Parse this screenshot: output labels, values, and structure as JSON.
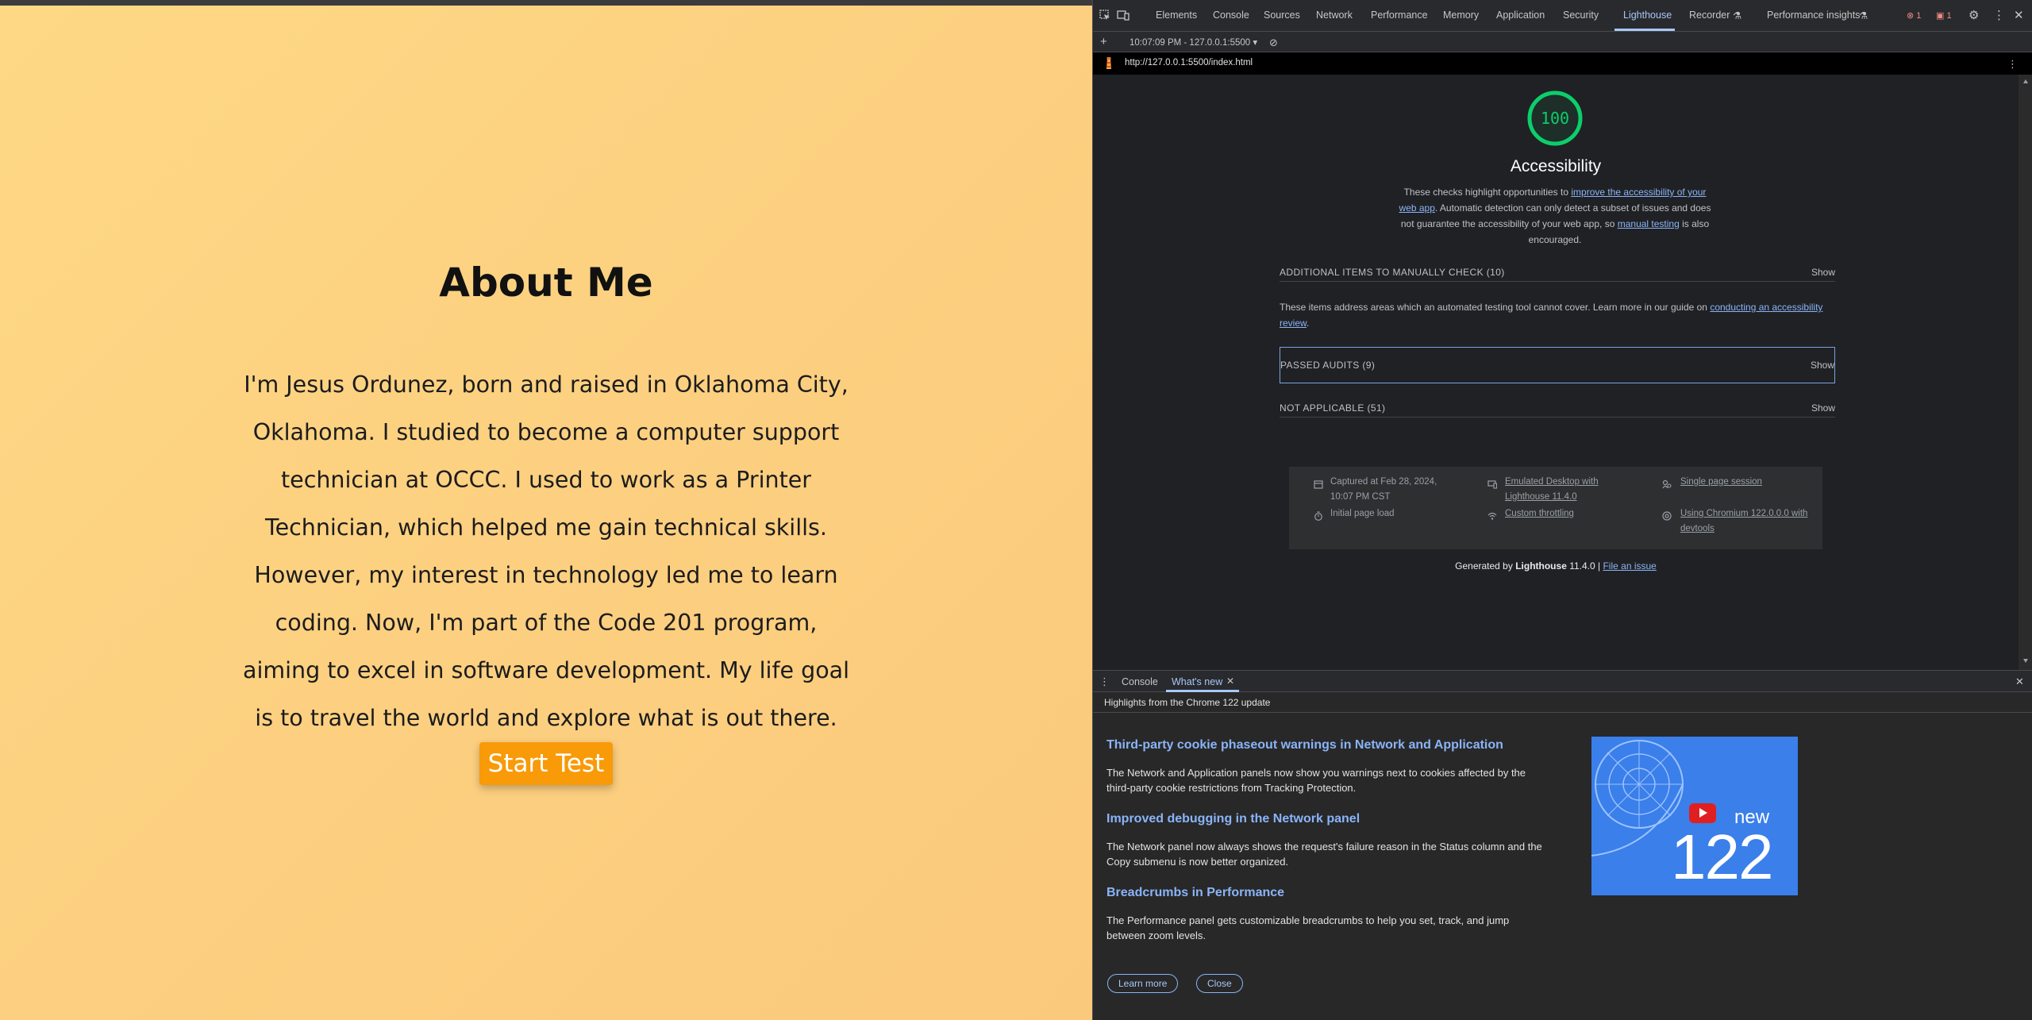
{
  "page": {
    "title": "About Me",
    "bio": "I'm Jesus Ordunez, born and raised in Oklahoma City, Oklahoma. I studied to become a computer support technician at OCCC. I used to work as a Printer Technician, which helped me gain technical skills. However, my interest in technology led me to learn coding. Now, I'm part of the Code 201 program, aiming to excel in software development. My life goal is to travel the world and explore what is out there.",
    "start_button": "Start Test"
  },
  "devtools": {
    "tabs": [
      "Elements",
      "Console",
      "Sources",
      "Network",
      "Performance",
      "Memory",
      "Application",
      "Security",
      "Lighthouse",
      "Recorder",
      "Performance insights"
    ],
    "active_tab": "Lighthouse",
    "error_count": "1",
    "issue_count": "1",
    "report_select": "10:07:09 PM - 127.0.0.1:5500",
    "report_url": "http://127.0.0.1:5500/index.html",
    "lighthouse": {
      "score": "100",
      "category_title": "Accessibility",
      "desc_1": "These checks highlight opportunities to ",
      "desc_link_1": "improve the accessibility of your web app",
      "desc_2": ". Automatic detection can only detect a subset of issues and does not guarantee the accessibility of your web app, so ",
      "desc_link_2": "manual testing",
      "desc_3": " is also encouraged.",
      "groups": [
        {
          "title": "ADDITIONAL ITEMS TO MANUALLY CHECK (10)",
          "action": "Show"
        },
        {
          "title": "PASSED AUDITS (9)",
          "action": "Show"
        },
        {
          "title": "NOT APPLICABLE (51)",
          "action": "Show"
        }
      ],
      "manual_desc": "These items address areas which an automated testing tool cannot cover. Learn more in our guide on ",
      "manual_link": "conducting an accessibility review",
      "manual_end": ".",
      "env": {
        "captured": "Captured at Feb 28, 2024, 10:07 PM CST",
        "load": "Initial page load",
        "emulation": "Emulated Desktop with Lighthouse 11.4.0",
        "throttling": "Custom throttling",
        "session": "Single page session",
        "browser": "Using Chromium 122.0.0.0 with devtools"
      },
      "footer_prefix": "Generated by ",
      "footer_brand": "Lighthouse",
      "footer_version": " 11.4.0 | ",
      "footer_link": "File an issue"
    },
    "drawer": {
      "tabs": [
        "Console",
        "What's new"
      ],
      "active_tab": "What's new",
      "subtitle": "Highlights from the Chrome 122 update",
      "items": [
        {
          "title": "Third-party cookie phaseout warnings in Network and Application",
          "text": "The Network and Application panels now show you warnings next to cookies affected by the third-party cookie restrictions from Tracking Protection."
        },
        {
          "title": "Improved debugging in the Network panel",
          "text": "The Network panel now always shows the request's failure reason in the Status column and the Copy submenu is now better organized."
        },
        {
          "title": "Breadcrumbs in Performance",
          "text": "The Performance panel gets customizable breadcrumbs to help you set, track, and jump between zoom levels."
        }
      ],
      "video_new": "new",
      "video_version": "122",
      "learn_more": "Learn more",
      "close": "Close"
    }
  },
  "colors": {
    "page_gradient": "#fed885",
    "start_button": "#f99a08",
    "score_green": "#0cce6b",
    "link_blue": "#8ab4f8",
    "error_red": "#f28b82"
  }
}
